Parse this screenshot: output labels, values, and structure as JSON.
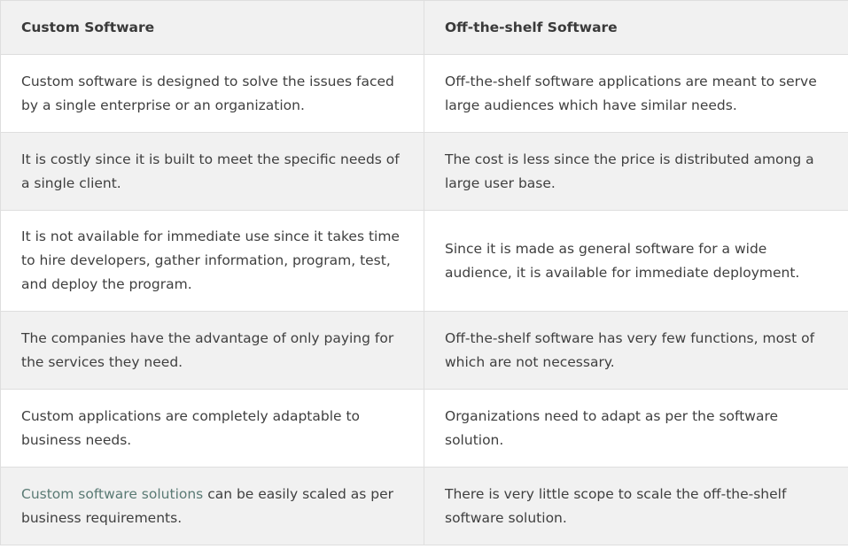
{
  "headers": {
    "custom": "Custom Software",
    "offshelf": "Off-the-shelf Software"
  },
  "rows": [
    {
      "custom": "Custom software is designed to solve the issues faced by a single enterprise or an organization.",
      "offshelf": "Off-the-shelf software applications are meant to serve large audiences which have similar needs."
    },
    {
      "custom": "It is costly since it is built to meet the specific needs of a single client.",
      "offshelf": "The cost is less since the price is distributed among a large user base."
    },
    {
      "custom": "It is not available for immediate use since it takes time to hire developers, gather information, program, test, and deploy the program.",
      "offshelf": "Since it is made as general software for a wide audience, it is available for immediate deployment."
    },
    {
      "custom": "The companies have the advantage of only paying for the services they need.",
      "offshelf": "Off-the-shelf software has very few functions, most of which are not necessary."
    },
    {
      "custom": "Custom applications are completely adaptable to business needs.",
      "offshelf": "Organizations need to adapt as per the software solution."
    },
    {
      "custom_link": "Custom software solutions",
      "custom": " can be easily scaled as per business requirements.",
      "offshelf": "There is very little scope to scale the off-the-shelf software solution."
    }
  ]
}
